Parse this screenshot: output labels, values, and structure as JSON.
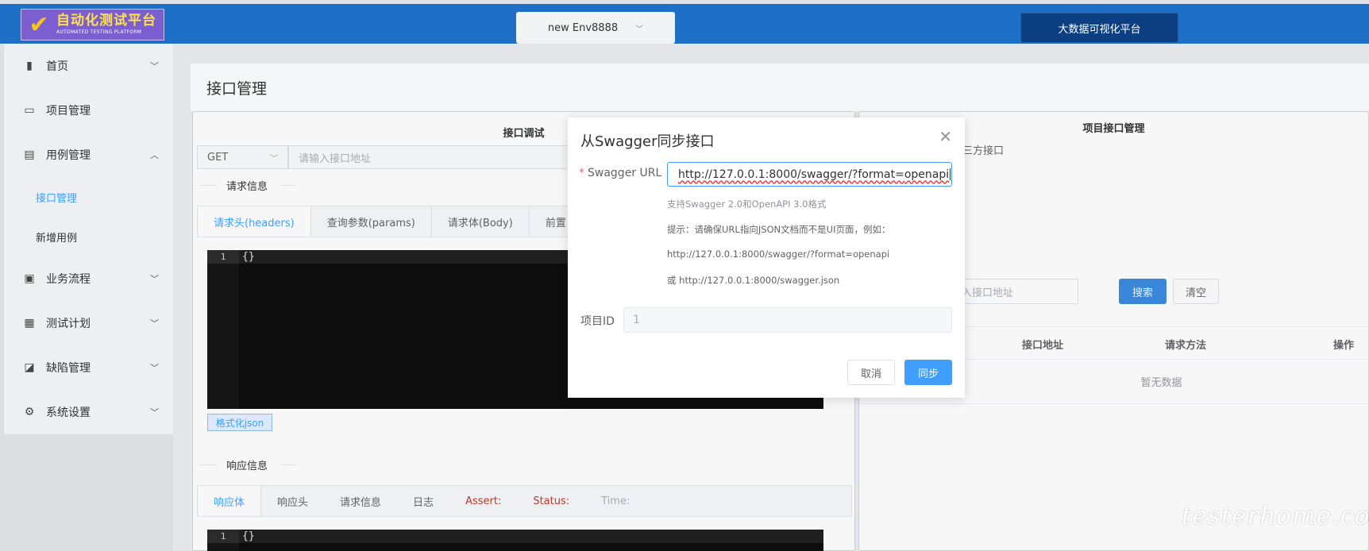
{
  "header": {
    "logo_cn": "自动化测试平台",
    "logo_en": "AUTOMATED TESTING PLATFORM",
    "env_select": "new Env8888",
    "bigdata_button": "大数据可视化平台"
  },
  "sidebar": {
    "items": [
      {
        "label": "首页",
        "icon": "bar-chart-icon"
      },
      {
        "label": "项目管理",
        "icon": "folder-icon"
      },
      {
        "label": "用例管理",
        "icon": "briefcase-icon"
      },
      {
        "label": "业务流程",
        "icon": "suitcase-icon"
      },
      {
        "label": "测试计划",
        "icon": "calendar-icon"
      },
      {
        "label": "缺陷管理",
        "icon": "trend-icon"
      },
      {
        "label": "系统设置",
        "icon": "gear-icon"
      }
    ],
    "sub_items": [
      {
        "label": "接口管理",
        "active": true
      },
      {
        "label": "新增用例",
        "active": false
      }
    ]
  },
  "page": {
    "title": "接口管理"
  },
  "api_debug": {
    "title": "接口调试",
    "method": "GET",
    "url_placeholder": "请输入接口地址",
    "request_section": "请求信息",
    "request_tabs": [
      "请求头(headers)",
      "查询参数(params)",
      "请求体(Body)",
      "前置"
    ],
    "editor_line": "1",
    "editor_code": "{}",
    "format_button": "格式化json",
    "response_section": "响应信息",
    "response_tabs": [
      "响应体",
      "响应头",
      "请求信息",
      "日志",
      "Assert:",
      "Status:",
      "Time:"
    ],
    "response_editor_line": "1",
    "response_editor_code": "{}"
  },
  "project_api": {
    "title": "项目接口管理",
    "third_party_label": "三方接口",
    "search_placeholder": "输入接口地址",
    "search_button": "搜索",
    "clear_button": "清空",
    "columns": [
      "接口地址",
      "请求方法",
      "操作"
    ],
    "empty_text": "暂无数据"
  },
  "dialog": {
    "title": "从Swagger同步接口",
    "swagger_label": "Swagger URL",
    "swagger_value_prefix": "http://127.0.0.1:8000/swagger/?format=",
    "swagger_value_suffix": "openapi",
    "support_hint": "支持Swagger 2.0和OpenAPI 3.0格式",
    "tip_hint": "提示：请确保URL指向JSON文档而不是UI页面，例如：",
    "example_1": "http://127.0.0.1:8000/swagger/?format=openapi",
    "example_2": "或 http://127.0.0.1:8000/swagger.json",
    "project_id_label": "项目ID",
    "project_id_value": "1",
    "cancel_button": "取消",
    "sync_button": "同步"
  },
  "watermark": "testerhome.com",
  "colors": {
    "topbar": "#1e6fc8",
    "primary": "#409eff",
    "assert_red": "#c0392b"
  }
}
